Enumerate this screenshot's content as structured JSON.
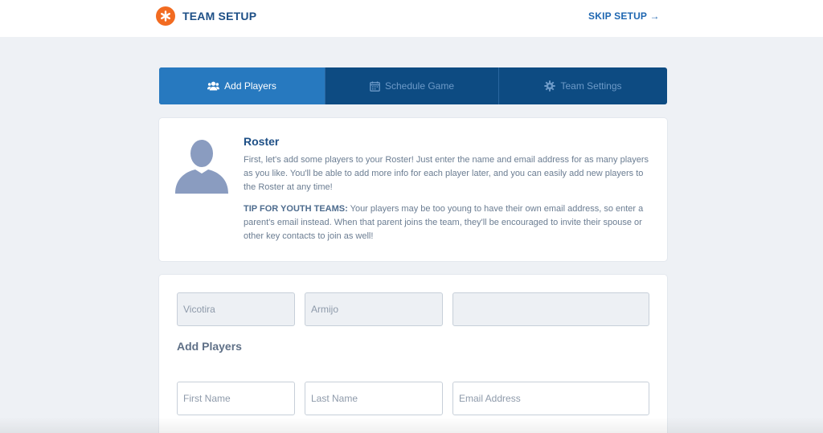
{
  "header": {
    "title": "TEAM SETUP",
    "skip_label": "SKIP SETUP →",
    "logo_icon": "asterisk-icon",
    "brand_color": "#f26b21"
  },
  "tabs": [
    {
      "label": "Add Players",
      "icon": "users-icon",
      "active": true
    },
    {
      "label": "Schedule Game",
      "icon": "calendar-icon",
      "active": false
    },
    {
      "label": "Team Settings",
      "icon": "gear-icon",
      "active": false
    }
  ],
  "roster": {
    "title": "Roster",
    "description": "First, let's add some players to your Roster! Just enter the name and email address for as many players as you like. You'll be able to add more info for each player later, and you can easily add new players to the Roster at any time!",
    "tip_label": "TIP FOR YOUTH TEAMS:",
    "tip_text": " Your players may be too young to have their own email address, so enter a parent's email instead. When that parent joins the team, they'll be encouraged to invite their spouse or other key contacts to join as well!"
  },
  "players": {
    "existing": {
      "first_name": "Vicotira",
      "last_name": "Armijo",
      "email": ""
    },
    "section_title": "Add Players",
    "new_row": {
      "first_name_placeholder": "First Name",
      "last_name_placeholder": "Last Name",
      "email_placeholder": "Email Address"
    }
  }
}
